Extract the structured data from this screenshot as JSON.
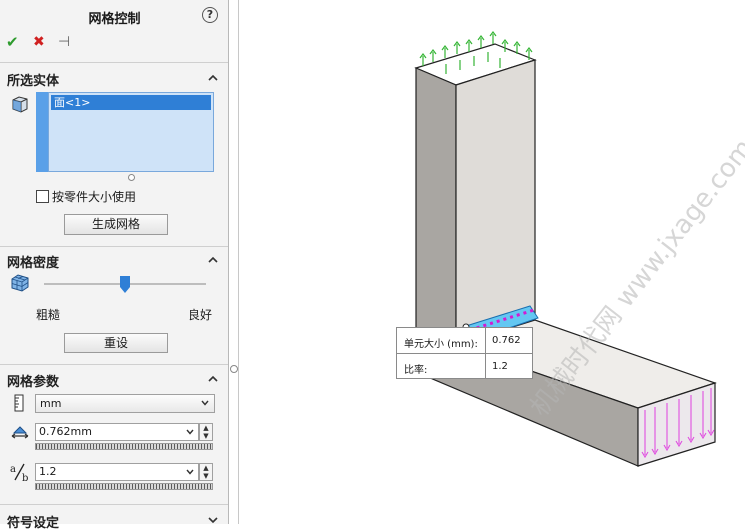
{
  "panel": {
    "title": "网格控制",
    "help": "?",
    "actions": {
      "ok": "✔",
      "cancel": "✖",
      "pin": "⊣"
    }
  },
  "selected_entities": {
    "header": "所选实体",
    "items": [
      "面<1>"
    ],
    "use_part_size_label": "按零件大小使用",
    "use_part_size_checked": false,
    "create_mesh_button": "生成网格"
  },
  "mesh_density": {
    "header": "网格密度",
    "coarse_label": "粗糙",
    "fine_label": "良好",
    "level": 0.5,
    "reset_button": "重设"
  },
  "mesh_parameters": {
    "header": "网格参数",
    "unit": "mm",
    "element_size": "0.762mm",
    "ratio": "1.2"
  },
  "next_section": {
    "header": "符号设定"
  },
  "tooltip": {
    "element_size_label": "单元大小 (mm):",
    "element_size_value": "0.762",
    "ratio_label": "比率:",
    "ratio_value": "1.2"
  },
  "watermark": "机械时代网 www.jxage.com",
  "colors": {
    "selection": "#2f7fd6",
    "list_bg": "#cfe3f8",
    "ok": "#2e9b2e",
    "cancel": "#d02020"
  }
}
